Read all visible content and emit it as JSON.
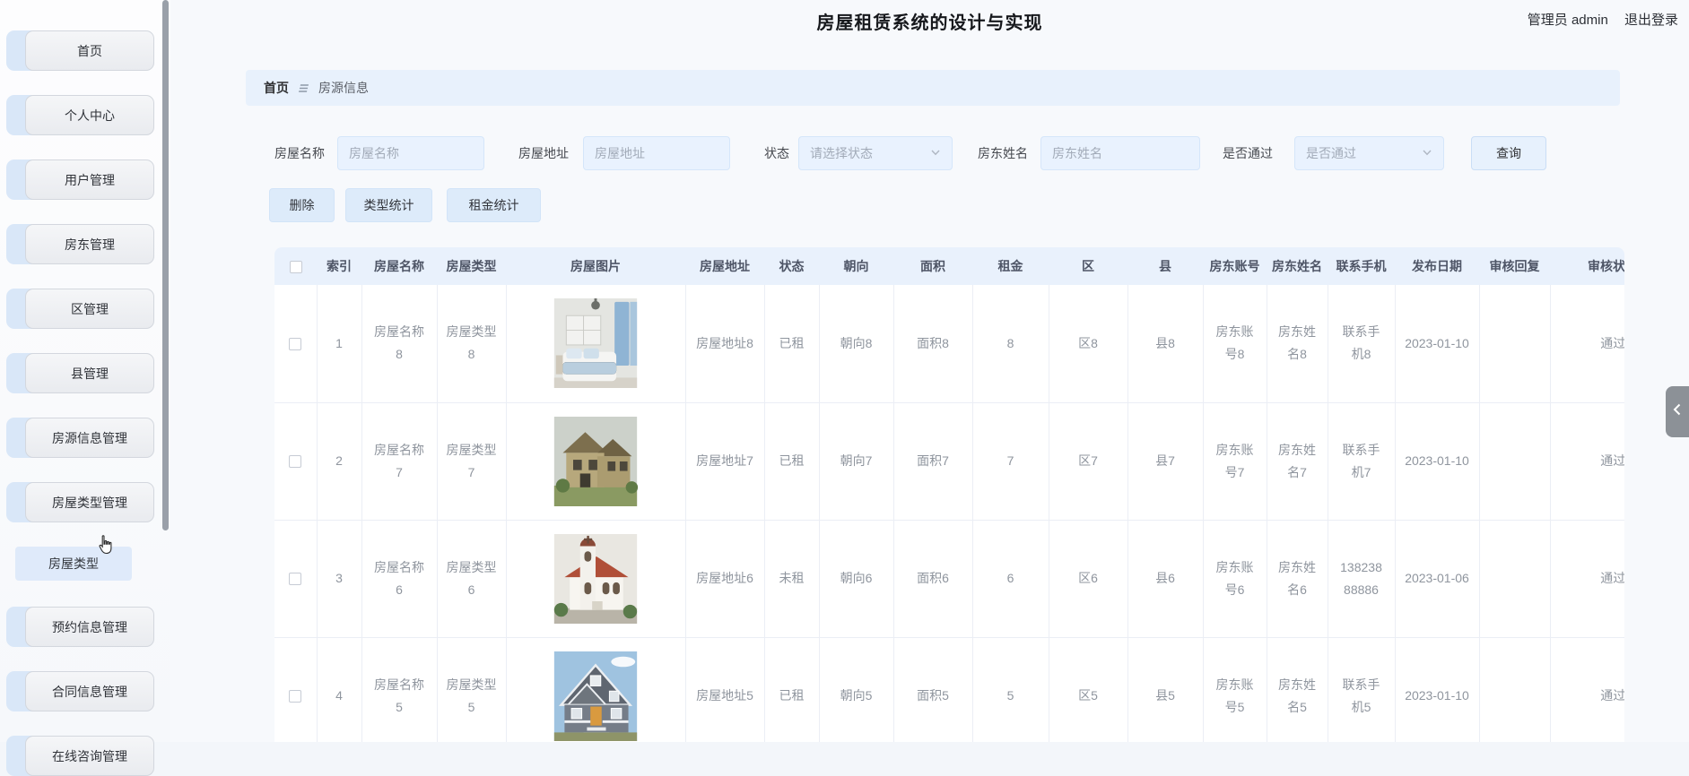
{
  "page": {
    "title": "房屋租赁系统的设计与实现"
  },
  "header": {
    "role_user": "管理员 admin",
    "logout": "退出登录"
  },
  "sidebar": {
    "items": [
      {
        "label": "首页",
        "type": "item"
      },
      {
        "label": "个人中心",
        "type": "item"
      },
      {
        "label": "用户管理",
        "type": "item"
      },
      {
        "label": "房东管理",
        "type": "item"
      },
      {
        "label": "区管理",
        "type": "item"
      },
      {
        "label": "县管理",
        "type": "item"
      },
      {
        "label": "房源信息管理",
        "type": "item"
      },
      {
        "label": "房屋类型管理",
        "type": "item"
      },
      {
        "label": "房屋类型",
        "type": "submenu-active"
      },
      {
        "label": "预约信息管理",
        "type": "item"
      },
      {
        "label": "合同信息管理",
        "type": "item"
      },
      {
        "label": "在线咨询管理",
        "type": "item"
      }
    ]
  },
  "breadcrumb": {
    "home": "首页",
    "current": "房源信息"
  },
  "filters": {
    "name": {
      "label": "房屋名称",
      "placeholder": "房屋名称"
    },
    "address": {
      "label": "房屋地址",
      "placeholder": "房屋地址"
    },
    "status": {
      "label": "状态",
      "placeholder": "请选择状态"
    },
    "landlord": {
      "label": "房东姓名",
      "placeholder": "房东姓名"
    },
    "approved": {
      "label": "是否通过",
      "placeholder": "是否通过"
    },
    "search_button": "查询"
  },
  "actions": {
    "delete": "删除",
    "type_stats": "类型统计",
    "rent_stats": "租金统计"
  },
  "table": {
    "columns": [
      "索引",
      "房屋名称",
      "房屋类型",
      "房屋图片",
      "房屋地址",
      "状态",
      "朝向",
      "面积",
      "租金",
      "区",
      "县",
      "房东账号",
      "房东姓名",
      "联系手机",
      "发布日期",
      "审核回复",
      "审核状态"
    ],
    "rows": [
      {
        "index": "1",
        "name": "房屋名称8",
        "type": "房屋类型8",
        "image": "bedroom-interior",
        "address": "房屋地址8",
        "status": "已租",
        "orientation": "朝向8",
        "area": "面积8",
        "rent": "8",
        "district": "区8",
        "county": "县8",
        "landlord_account": "房东账号8",
        "landlord_name": "房东姓名8",
        "phone": "联系手机8",
        "publish_date": "2023-01-10",
        "audit_reply": "",
        "audit_status": "通过"
      },
      {
        "index": "2",
        "name": "房屋名称7",
        "type": "房屋类型7",
        "image": "beige-two-story-house",
        "address": "房屋地址7",
        "status": "已租",
        "orientation": "朝向7",
        "area": "面积7",
        "rent": "7",
        "district": "区7",
        "county": "县7",
        "landlord_account": "房东账号7",
        "landlord_name": "房东姓名7",
        "phone": "联系手机7",
        "publish_date": "2023-01-10",
        "audit_reply": "",
        "audit_status": "通过"
      },
      {
        "index": "3",
        "name": "房屋名称6",
        "type": "房屋类型6",
        "image": "white-church-red-roof",
        "address": "房屋地址6",
        "status": "未租",
        "orientation": "朝向6",
        "area": "面积6",
        "rent": "6",
        "district": "区6",
        "county": "县6",
        "landlord_account": "房东账号6",
        "landlord_name": "房东姓名6",
        "phone": "13823888886",
        "publish_date": "2023-01-06",
        "audit_reply": "",
        "audit_status": "通过"
      },
      {
        "index": "4",
        "name": "房屋名称5",
        "type": "房屋类型5",
        "image": "gray-gable-house",
        "address": "房屋地址5",
        "status": "已租",
        "orientation": "朝向5",
        "area": "面积5",
        "rent": "5",
        "district": "区5",
        "county": "县5",
        "landlord_account": "房东账号5",
        "landlord_name": "房东姓名5",
        "phone": "联系手机5",
        "publish_date": "2023-01-10",
        "audit_reply": "",
        "audit_status": "通过"
      }
    ]
  },
  "colors": {
    "accent_light_blue": "#e8f1fc",
    "table_header_bg": "#e9f1fc",
    "page_bg": "#f7f9fc",
    "handle_gray": "#8c9197"
  }
}
